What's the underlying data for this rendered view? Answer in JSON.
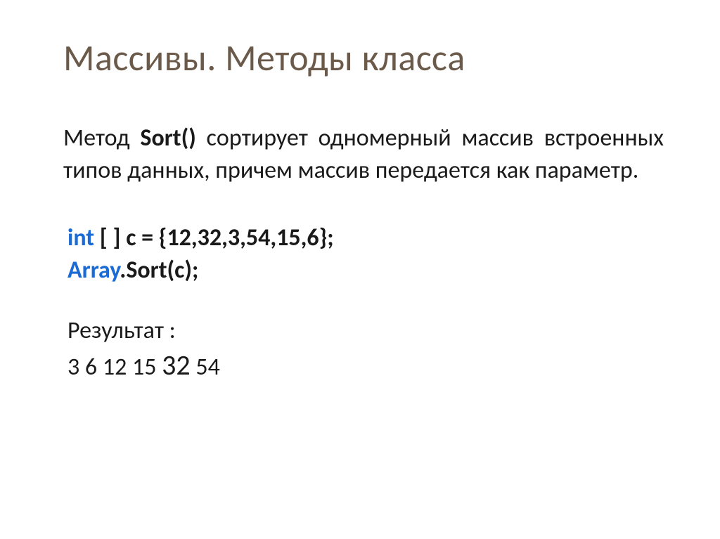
{
  "slide": {
    "title": "Массивы. Методы класса",
    "description_parts": {
      "prefix": "Метод ",
      "method_name": "Sort()",
      "suffix": " сортирует одномерный массив встроенных типов данных, причем массив передается как параметр."
    },
    "code": {
      "line1": {
        "keyword": "int",
        "rest": " [ ] c = {12,32,3,54,15,6};"
      },
      "line2": {
        "class_name": "Array",
        "rest": ".Sort(c);"
      }
    },
    "result": {
      "label": "Результат :",
      "values_prefix": "3  6  12  15  ",
      "values_big": "32",
      "values_suffix": "   54"
    }
  }
}
